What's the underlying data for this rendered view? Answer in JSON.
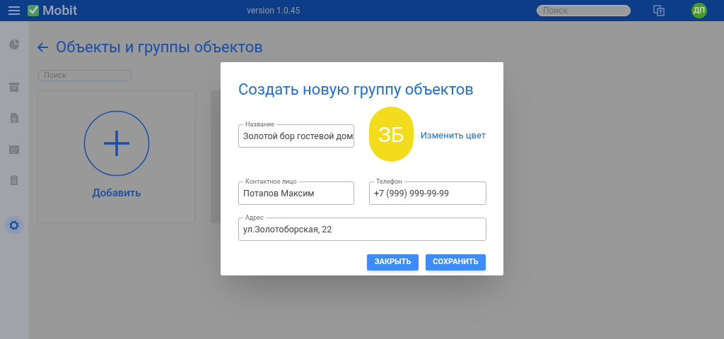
{
  "header": {
    "app_name": "Mobit",
    "version": "version 1.0.45",
    "search": {
      "placeholder": "Поиск"
    },
    "avatar": "ДП"
  },
  "sidebar": {
    "items": [
      {
        "selected": false
      },
      {
        "selected": false
      },
      {
        "selected": false
      },
      {
        "selected": false
      },
      {
        "selected": false
      },
      {
        "selected": true
      }
    ]
  },
  "page": {
    "title": "Объекты и группы объектов",
    "search": {
      "placeholder": "Поиск"
    },
    "add_card": {
      "label": "Добавить"
    }
  },
  "dialog": {
    "title": "Создать новую группу объектов",
    "fields": [
      {
        "label": "Название",
        "value": "Золотой бор гостевой дом"
      },
      {
        "label": "Контактное лицо",
        "value": "Потапов Максим"
      },
      {
        "label": "Телефон",
        "value": "+7 (999) 999-99-99"
      },
      {
        "label": "Адрес",
        "value": "ул.Золотоборская, 22"
      }
    ],
    "badge": {
      "initials": "ЗБ",
      "color": "#f2dc1b"
    },
    "change_color": "Изменить цвет",
    "buttons": [
      "ЗАКРЫТЬ",
      "СОХРАНИТЬ"
    ]
  }
}
